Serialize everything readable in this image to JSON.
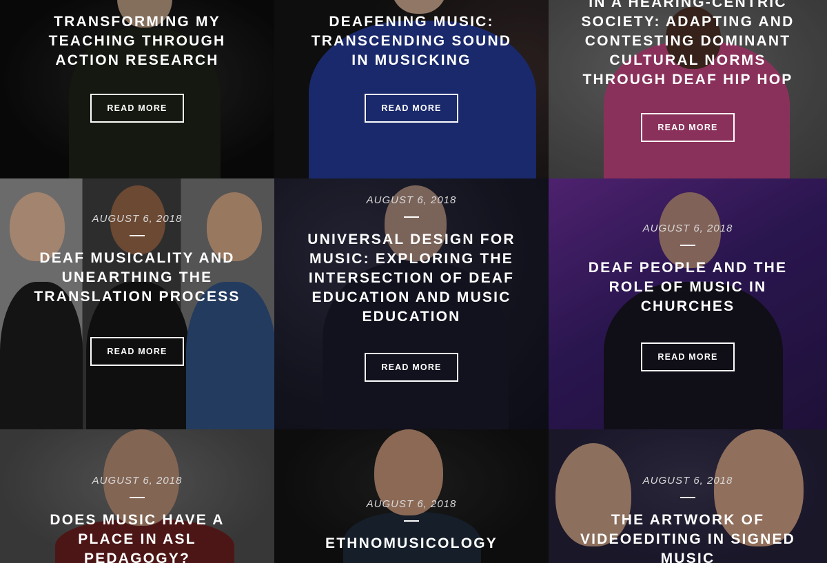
{
  "cards": [
    {
      "date": "",
      "title": "Transforming my Teaching Through Action Research",
      "button": "Read More"
    },
    {
      "date": "",
      "title": "Deafening Music: Transcending Sound in Musicking",
      "button": "Read More"
    },
    {
      "date": "",
      "title": "in a Hearing-Centric Society: Adapting and Contesting Dominant Cultural Norms Through Deaf Hip Hop",
      "button": "Read More"
    },
    {
      "date": "August 6, 2018",
      "title": "Deaf Musicality and Unearthing the Translation Process",
      "button": "Read More"
    },
    {
      "date": "August 6, 2018",
      "title": "Universal Design for Music: Exploring the Intersection of Deaf Education and Music Education",
      "button": "Read More"
    },
    {
      "date": "August 6, 2018",
      "title": "Deaf People and the Role of Music in Churches",
      "button": "Read More"
    },
    {
      "date": "August 6, 2018",
      "title": "Does Music Have a Place in ASL Pedagogy?",
      "button": ""
    },
    {
      "date": "August 6, 2018",
      "title": "Ethnomusicology",
      "button": ""
    },
    {
      "date": "August 6, 2018",
      "title": "The Artwork of Videoediting in Signed Music",
      "button": ""
    }
  ],
  "colors": {
    "text": "#ffffff",
    "date": "#d9d9d9",
    "purple_bg": "#3b1f6e",
    "pink_shirt": "#c2467f",
    "blue_shirt": "#2a3f9a"
  }
}
